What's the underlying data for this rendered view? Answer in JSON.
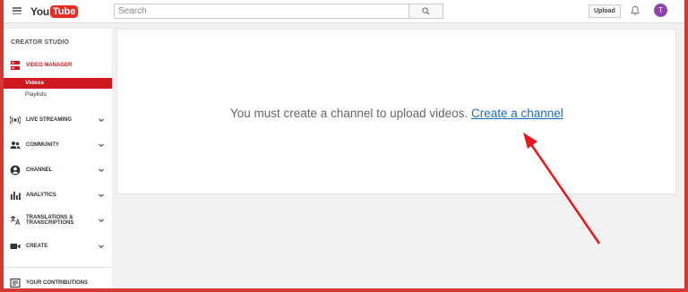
{
  "topbar": {
    "logo_you": "You",
    "logo_tube": "Tube",
    "search_placeholder": "Search",
    "upload_label": "Upload",
    "avatar_letter": "T"
  },
  "sidebar": {
    "title": "CREATOR STUDIO",
    "video_manager": "VIDEO MANAGER",
    "sub_items": [
      "Videos",
      "Playlists"
    ],
    "items": [
      {
        "label": "LIVE STREAMING",
        "icon": "live-icon"
      },
      {
        "label": "COMMUNITY",
        "icon": "community-icon"
      },
      {
        "label": "CHANNEL",
        "icon": "channel-icon"
      },
      {
        "label": "ANALYTICS",
        "icon": "analytics-icon"
      },
      {
        "label": "TRANSLATIONS & TRANSCRIPTIONS",
        "icon": "translate-icon"
      },
      {
        "label": "CREATE",
        "icon": "camera-icon"
      }
    ],
    "contributions": "YOUR CONTRIBUTIONS"
  },
  "main": {
    "message": "You must create a channel to upload videos.",
    "link": "Create a channel"
  },
  "colors": {
    "accent": "#cc181e",
    "link": "#1e6bb8",
    "annotation_arrow": "#e8161b",
    "border": "#d33a35"
  }
}
